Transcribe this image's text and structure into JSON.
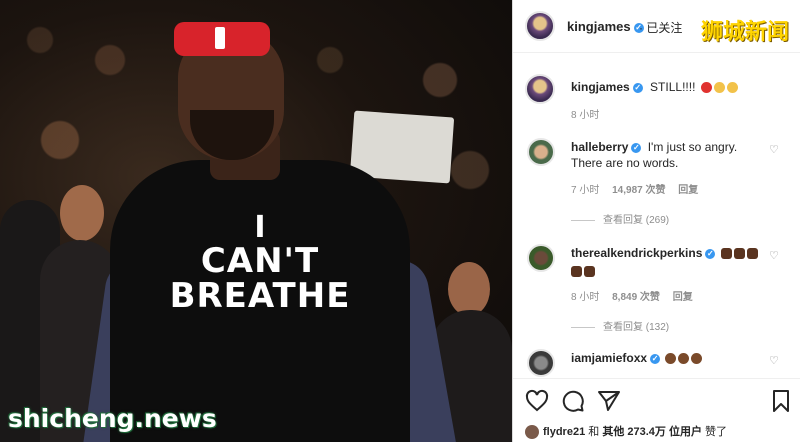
{
  "photo": {
    "shirt_line1": "I",
    "shirt_line2": "CAN'T",
    "shirt_line3": "BREATHE",
    "watermark": "shicheng.news"
  },
  "post": {
    "username": "kingjames",
    "follow_status": "· 已关注",
    "brand_overlay": "狮城新闻"
  },
  "caption": {
    "username": "kingjames",
    "text": "STILL!!!!",
    "time": "8 小时"
  },
  "comments": [
    {
      "username": "halleberry",
      "text_line1": "I'm just so angry.",
      "text_line2": "There are no words.",
      "time": "7 小时",
      "likes": "14,987 次赞",
      "reply": "回复",
      "view_replies": "查看回复 (269)"
    },
    {
      "username": "therealkendrickperkins",
      "time": "8 小时",
      "likes": "8,849 次赞",
      "reply": "回复",
      "view_replies": "查看回复 (132)"
    },
    {
      "username": "iamjamiefoxx"
    }
  ],
  "likes_line": {
    "user": "flydre21",
    "connector": "和",
    "others": "其他 273.4万 位用户",
    "suffix": "赞了"
  },
  "icons": {
    "like": "heart-icon",
    "comment": "comment-icon",
    "share": "share-icon",
    "save": "bookmark-icon"
  }
}
